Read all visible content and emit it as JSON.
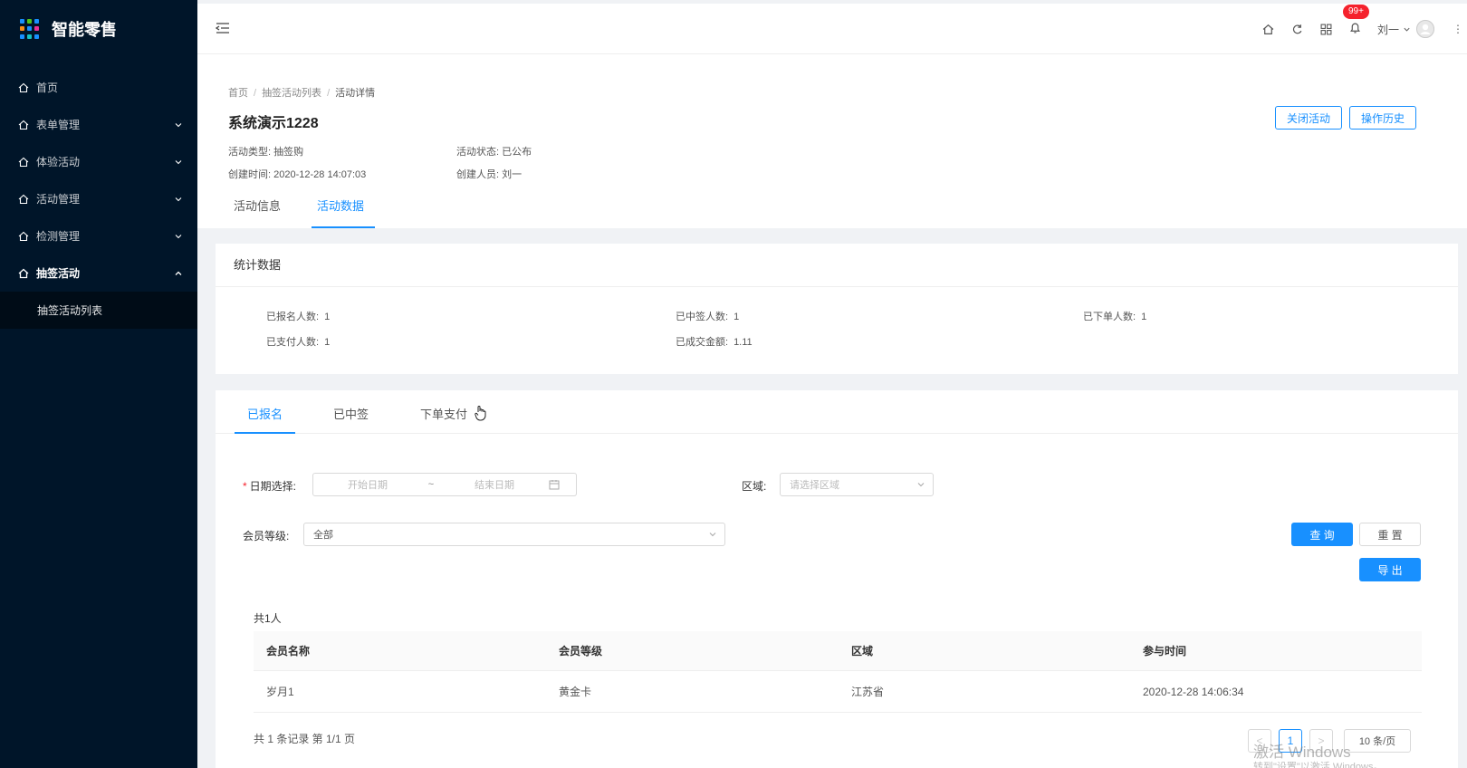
{
  "app": {
    "title": "智能零售"
  },
  "colors": {
    "sidebar_bg": "#001529",
    "accent": "#1890ff",
    "badge": "#f5222d"
  },
  "sidebar": {
    "items": [
      {
        "label": "首页",
        "icon": "home-icon",
        "has_arrow": false
      },
      {
        "label": "表单管理",
        "icon": "home-icon",
        "has_arrow": true
      },
      {
        "label": "体验活动",
        "icon": "home-icon",
        "has_arrow": true
      },
      {
        "label": "活动管理",
        "icon": "home-icon",
        "has_arrow": true
      },
      {
        "label": "检测管理",
        "icon": "home-icon",
        "has_arrow": true
      },
      {
        "label": "抽签活动",
        "icon": "home-icon",
        "has_arrow": true,
        "open": true
      }
    ],
    "subitems": [
      {
        "label": "抽签活动列表"
      }
    ]
  },
  "header": {
    "notification_badge": "99+",
    "user_name": "刘一",
    "icons": [
      "home-icon",
      "refresh-icon",
      "grid-icon",
      "bell-icon"
    ]
  },
  "breadcrumb": [
    "首页",
    "抽签活动列表",
    "活动详情"
  ],
  "page": {
    "title": "系统演示1228",
    "meta": {
      "type_label": "活动类型:",
      "type_value": "抽签购",
      "status_label": "活动状态:",
      "status_value": "已公布",
      "created_label": "创建时间:",
      "created_value": "2020-12-28 14:07:03",
      "creator_label": "创建人员:",
      "creator_value": "刘一"
    },
    "actions": {
      "close": "关闭活动",
      "history": "操作历史"
    },
    "tabs": [
      {
        "label": "活动信息",
        "active": false
      },
      {
        "label": "活动数据",
        "active": true
      }
    ]
  },
  "stats": {
    "title": "统计数据",
    "items": [
      {
        "label": "已报名人数:",
        "value": "1"
      },
      {
        "label": "已中签人数:",
        "value": "1"
      },
      {
        "label": "已下单人数:",
        "value": "1"
      },
      {
        "label": "已支付人数:",
        "value": "1"
      },
      {
        "label": "已成交金额:",
        "value": "1.11"
      }
    ]
  },
  "main_tabs": [
    {
      "label": "已报名",
      "active": true
    },
    {
      "label": "已中签",
      "active": false
    },
    {
      "label": "下单支付",
      "active": false
    }
  ],
  "filters": {
    "date_label": "日期选择:",
    "date_required": "*",
    "start_placeholder": "开始日期",
    "date_separator": "~",
    "end_placeholder": "结束日期",
    "region_label": "区域:",
    "region_placeholder": "请选择区域",
    "level_label": "会员等级:",
    "level_value": "全部",
    "query_button": "查 询",
    "reset_button": "重 置",
    "export_button": "导 出"
  },
  "table": {
    "total": "共1人",
    "columns": [
      "会员名称",
      "会员等级",
      "区域",
      "参与时间"
    ],
    "rows": [
      [
        "岁月1",
        "黄金卡",
        "江苏省",
        "2020-12-28 14:06:34"
      ]
    ]
  },
  "pagination": {
    "summary": "共 1 条记录 第 1/1 页",
    "prev": "<",
    "current_page": "1",
    "next": ">",
    "page_size": "10 条/页"
  },
  "watermark": {
    "line1": "激活 Windows",
    "line2": "转到\"设置\"以激活 Windows。"
  }
}
